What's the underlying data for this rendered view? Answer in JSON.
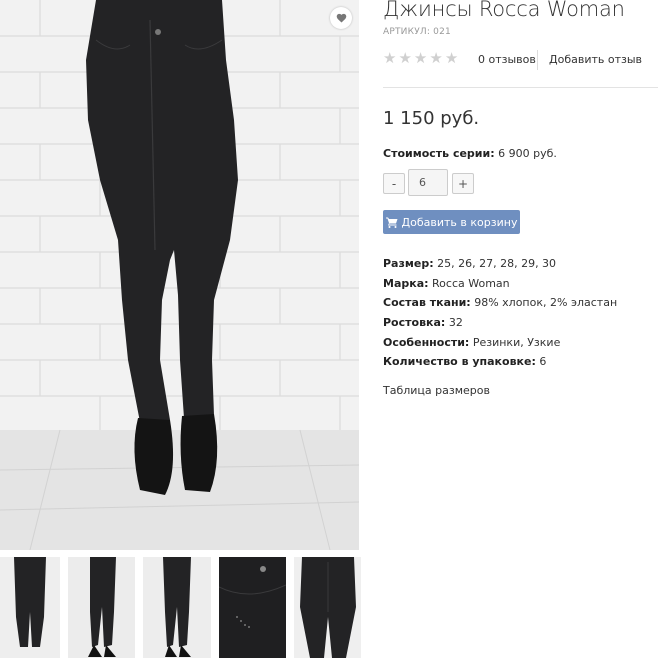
{
  "product": {
    "title": "Джинсы Rocca Woman",
    "sku": "АРТИКУЛ: 021",
    "rating_stars": 5,
    "reviews_label": "0 отзывов",
    "add_review_label": "Добавить отзыв",
    "price": "1 150 руб.",
    "series_label": "Стоимость серии:",
    "series_value": " 6 900 руб.",
    "quantity": "6",
    "minus_label": "-",
    "plus_label": "+",
    "cart_label": "Добавить в корзину",
    "size_table_link": "Таблица размеров"
  },
  "properties": [
    {
      "label": "Размер:",
      "value": " 25, 26, 27, 28, 29, 30"
    },
    {
      "label": "Марка:",
      "value": " Rocca Woman"
    },
    {
      "label": "Состав ткани:",
      "value": " 98% хлопок, 2% эластан"
    },
    {
      "label": "Ростовка:",
      "value": " 32"
    },
    {
      "label": "Особенности:",
      "value": " Резинки, Узкие"
    },
    {
      "label": "Количество в упаковке:",
      "value": " 6"
    }
  ],
  "icons": {
    "wishlist": "heart-icon",
    "star": "star-icon",
    "cart": "cart-icon"
  },
  "colors": {
    "accent_button": "#6f8fc0",
    "star_inactive": "#d0d0d0",
    "denim": "#232325"
  }
}
